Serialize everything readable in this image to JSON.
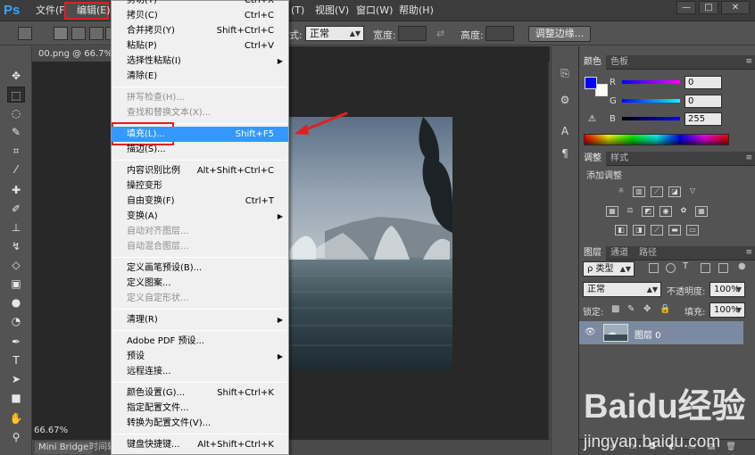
{
  "menubar": {
    "logo": "Ps",
    "file": "文件(F)",
    "edit": "编辑(E)",
    "extra": "(T)",
    "view": "视图(V)",
    "window": "窗口(W)",
    "help": "帮助(H)",
    "win_min": "—",
    "win_max": "□",
    "win_close": "✕"
  },
  "options": {
    "style_label": "式:",
    "style_value": "正常",
    "width_label": "宽度:",
    "height_label": "高度:",
    "refine_edge": "调整边缘..."
  },
  "document": {
    "tab_title": "00.png @ 66.7% (",
    "zoom": "66.67%",
    "tab_mini_bridge": "Mini Bridge",
    "tab_timeline": "时间轴"
  },
  "edit_menu": [
    {
      "type": "item",
      "label": "剪切(T)",
      "shortcut": "Ctrl+X",
      "enabled": true
    },
    {
      "type": "item",
      "label": "拷贝(C)",
      "shortcut": "Ctrl+C",
      "enabled": true
    },
    {
      "type": "item",
      "label": "合并拷贝(Y)",
      "shortcut": "Shift+Ctrl+C",
      "enabled": true
    },
    {
      "type": "item",
      "label": "粘贴(P)",
      "shortcut": "Ctrl+V",
      "enabled": true
    },
    {
      "type": "item",
      "label": "选择性粘贴(I)",
      "shortcut": "",
      "enabled": true,
      "submenu": true
    },
    {
      "type": "item",
      "label": "清除(E)",
      "shortcut": "",
      "enabled": true
    },
    {
      "type": "separator"
    },
    {
      "type": "item",
      "label": "拼写检查(H)...",
      "shortcut": "",
      "enabled": false
    },
    {
      "type": "item",
      "label": "查找和替换文本(X)...",
      "shortcut": "",
      "enabled": false
    },
    {
      "type": "separator"
    },
    {
      "type": "item",
      "label": "填充(L)...",
      "shortcut": "Shift+F5",
      "enabled": true,
      "highlighted": true
    },
    {
      "type": "item",
      "label": "描边(S)...",
      "shortcut": "",
      "enabled": true
    },
    {
      "type": "separator"
    },
    {
      "type": "item",
      "label": "内容识别比例",
      "shortcut": "Alt+Shift+Ctrl+C",
      "enabled": true
    },
    {
      "type": "item",
      "label": "操控变形",
      "shortcut": "",
      "enabled": true
    },
    {
      "type": "item",
      "label": "自由变换(F)",
      "shortcut": "Ctrl+T",
      "enabled": true
    },
    {
      "type": "item",
      "label": "变换(A)",
      "shortcut": "",
      "enabled": true,
      "submenu": true
    },
    {
      "type": "item",
      "label": "自动对齐图层...",
      "shortcut": "",
      "enabled": false
    },
    {
      "type": "item",
      "label": "自动混合图层...",
      "shortcut": "",
      "enabled": false
    },
    {
      "type": "separator"
    },
    {
      "type": "item",
      "label": "定义画笔预设(B)...",
      "shortcut": "",
      "enabled": true
    },
    {
      "type": "item",
      "label": "定义图案...",
      "shortcut": "",
      "enabled": true
    },
    {
      "type": "item",
      "label": "定义自定形状...",
      "shortcut": "",
      "enabled": false
    },
    {
      "type": "separator"
    },
    {
      "type": "item",
      "label": "清理(R)",
      "shortcut": "",
      "enabled": true,
      "submenu": true
    },
    {
      "type": "separator"
    },
    {
      "type": "item",
      "label": "Adobe PDF 预设...",
      "shortcut": "",
      "enabled": true
    },
    {
      "type": "item",
      "label": "预设",
      "shortcut": "",
      "enabled": true,
      "submenu": true
    },
    {
      "type": "item",
      "label": "远程连接...",
      "shortcut": "",
      "enabled": true
    },
    {
      "type": "separator"
    },
    {
      "type": "item",
      "label": "颜色设置(G)...",
      "shortcut": "Shift+Ctrl+K",
      "enabled": true
    },
    {
      "type": "item",
      "label": "指定配置文件...",
      "shortcut": "",
      "enabled": true
    },
    {
      "type": "item",
      "label": "转换为配置文件(V)...",
      "shortcut": "",
      "enabled": true
    },
    {
      "type": "separator"
    },
    {
      "type": "item",
      "label": "键盘快捷键...",
      "shortcut": "Alt+Shift+Ctrl+K",
      "enabled": true
    }
  ],
  "color_panel": {
    "tab_color": "颜色",
    "tab_swatches": "色板",
    "r_label": "R",
    "g_label": "G",
    "b_label": "B",
    "r_value": "0",
    "g_value": "0",
    "b_value": "255",
    "foreground": "#0000ff",
    "background": "#ffffff"
  },
  "adjust_panel": {
    "tab_adjust": "调整",
    "tab_styles": "样式",
    "title": "添加调整"
  },
  "layers_panel": {
    "tab_layers": "图层",
    "tab_channels": "通道",
    "tab_paths": "路径",
    "filter_type": "ρ 类型",
    "blend_mode": "正常",
    "opacity_label": "不透明度:",
    "opacity_value": "100%",
    "lock_label": "锁定:",
    "fill_label": "填充:",
    "fill_value": "100%",
    "layer_name": "图层 0",
    "bottom_icons": [
      "go-link",
      "fx",
      "□",
      "◐",
      "▭",
      "▤",
      "🗑"
    ]
  },
  "watermark": {
    "brand": "Baidu经验",
    "url": "jingyan.baidu.com"
  }
}
